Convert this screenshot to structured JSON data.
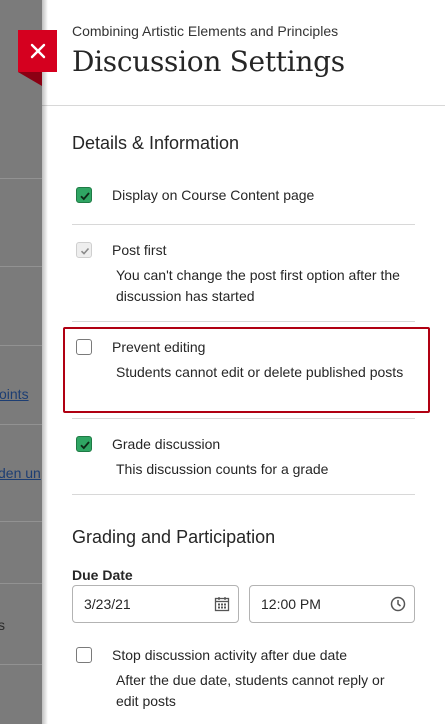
{
  "background": {
    "link_1": "oints",
    "link_2": "den un",
    "text_1": "s"
  },
  "header": {
    "course_name": "Combining Artistic Elements and Principles",
    "title": "Discussion Settings"
  },
  "close_icon": "close-icon",
  "details": {
    "section_title": "Details & Information",
    "options": [
      {
        "label": "Display on Course Content page",
        "state": "checked"
      },
      {
        "label": "Post first",
        "description": "You can't change the post first option after the discussion has started",
        "state": "checked-disabled"
      },
      {
        "label": "Prevent editing",
        "description": "Students cannot edit or delete published posts",
        "state": "unchecked"
      },
      {
        "label": "Grade discussion",
        "description": "This discussion counts for a grade",
        "state": "checked"
      }
    ]
  },
  "grading": {
    "section_title": "Grading and Participation",
    "due_date_label": "Due Date",
    "due_date": "3/23/21",
    "due_time": "12:00 PM",
    "stop_option": {
      "label": "Stop discussion activity after due date",
      "description": "After the due date, students cannot reply or edit posts",
      "state": "unchecked"
    }
  },
  "colors": {
    "accent_red": "#d5001f",
    "check_green": "#2fa563",
    "highlight_border": "#b00012"
  }
}
